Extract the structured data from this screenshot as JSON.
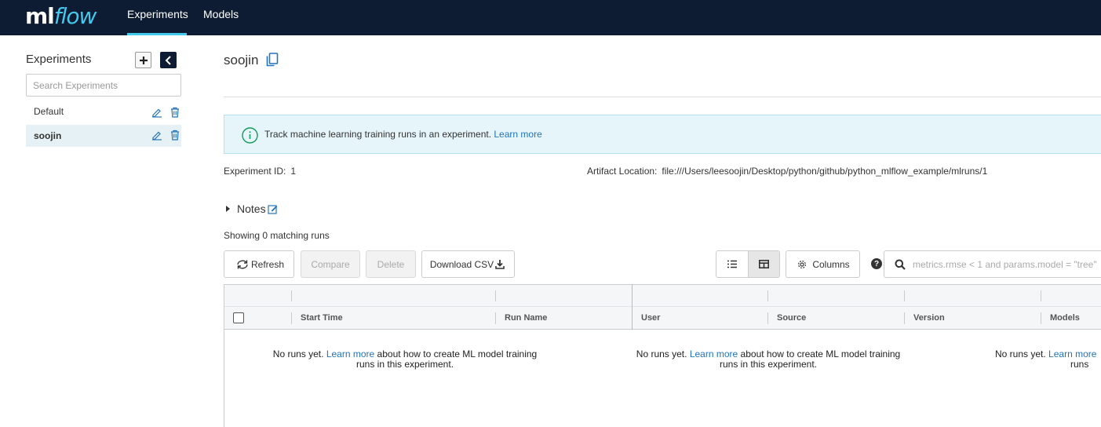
{
  "nav": {
    "logo_ml": "ml",
    "logo_flow": "flow",
    "tabs": [
      {
        "label": "Experiments",
        "active": true
      },
      {
        "label": "Models",
        "active": false
      }
    ]
  },
  "sidebar": {
    "title": "Experiments",
    "search_placeholder": "Search Experiments",
    "items": [
      {
        "label": "Default",
        "active": false
      },
      {
        "label": "soojin",
        "active": true
      }
    ]
  },
  "experiment": {
    "name": "soojin",
    "info_text": "Track machine learning training runs in an experiment.",
    "info_link": "Learn more",
    "id_label": "Experiment ID:",
    "id_value": "1",
    "artifact_label": "Artifact Location:",
    "artifact_value": "file:///Users/leesoojin/Desktop/python/github/python_mlflow_example/mlruns/1",
    "notes_label": "Notes"
  },
  "runs": {
    "showing_text": "Showing 0 matching runs",
    "buttons": {
      "refresh": "Refresh",
      "compare": "Compare",
      "delete": "Delete",
      "download_csv": "Download CSV",
      "columns": "Columns"
    },
    "search_placeholder": "metrics.rmse < 1 and params.model = \"tree\"",
    "columns": [
      "Start Time",
      "Run Name",
      "User",
      "Source",
      "Version",
      "Models"
    ],
    "empty": {
      "prefix": "No runs yet.",
      "link": "Learn more",
      "suffix": "about how to create ML model training",
      "line2": "runs in this experiment.",
      "line2_cut": "runs"
    }
  },
  "colors": {
    "nav_bg": "#0d1c32",
    "accent": "#43c9ed",
    "link": "#2374bb",
    "info_bg": "#e6f5fa",
    "info_icon": "#149a5a"
  }
}
